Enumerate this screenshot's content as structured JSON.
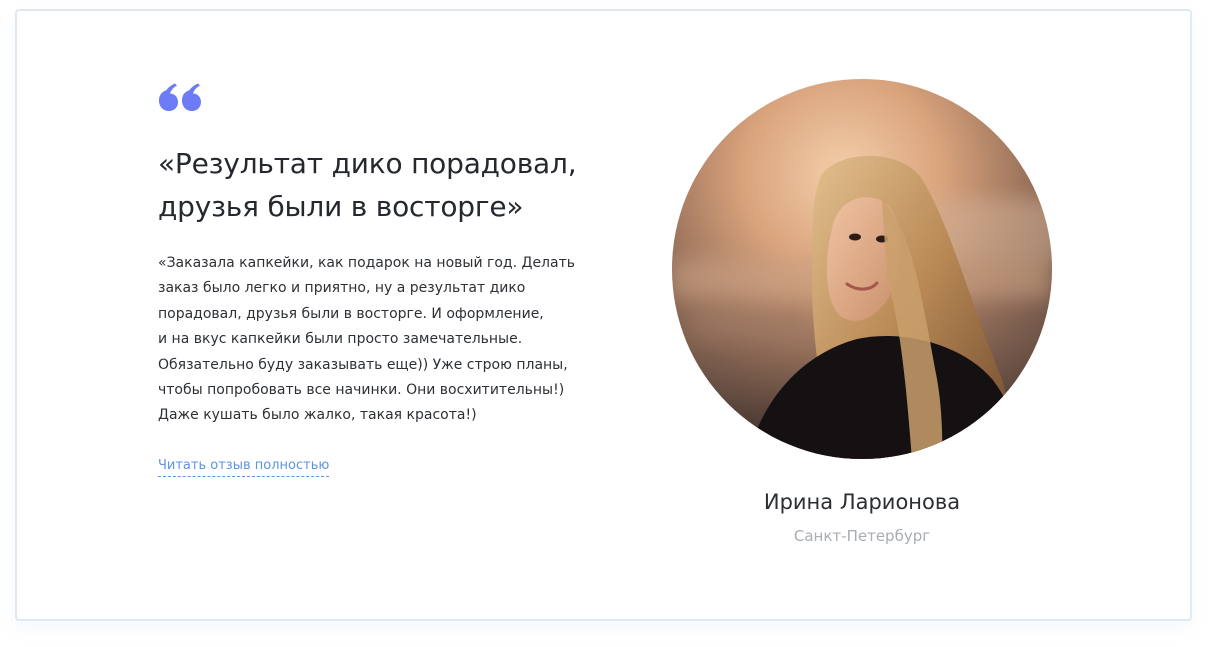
{
  "testimonial": {
    "headline_line1": "«Результат дико порадовал,",
    "headline_line2": "друзья были в восторге»",
    "review_text": "«Заказала капкейки, как подарок на новый год. Делать\nзаказ было легко и приятно, ну а результат дико\nпорадовал, друзья были в восторге. И оформление,\nи на вкус капкейки были просто замечательные.\nОбязательно буду заказывать еще)) Уже строю планы,\nчтобы попробовать все начинки. Они восхитительны!)\nДаже кушать было жалко, такая красота!)",
    "read_more_label": "Читать отзыв полностью",
    "quote_icon": "quote-icon",
    "accent_color": "#6b7cf6",
    "link_color": "#5b95e1"
  },
  "author": {
    "name": "Ирина Ларионова",
    "city": "Санкт-Петербург",
    "photo_icon": "avatar-photo"
  }
}
